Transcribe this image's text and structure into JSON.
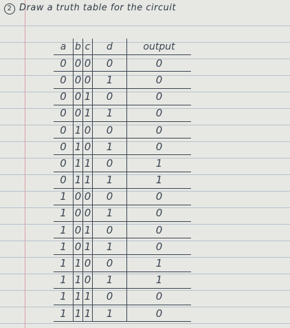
{
  "heading": {
    "number": "2",
    "text": "Draw a truth table for the circuit"
  },
  "table": {
    "columns": [
      "a",
      "b",
      "c",
      "d",
      "output"
    ],
    "rows": [
      [
        "0",
        "0",
        "0",
        "0",
        "0"
      ],
      [
        "0",
        "0",
        "0",
        "1",
        "0"
      ],
      [
        "0",
        "0",
        "1",
        "0",
        "0"
      ],
      [
        "0",
        "0",
        "1",
        "1",
        "0"
      ],
      [
        "0",
        "1",
        "0",
        "0",
        "0"
      ],
      [
        "0",
        "1",
        "0",
        "1",
        "0"
      ],
      [
        "0",
        "1",
        "1",
        "0",
        "1"
      ],
      [
        "0",
        "1",
        "1",
        "1",
        "1"
      ],
      [
        "1",
        "0",
        "0",
        "0",
        "0"
      ],
      [
        "1",
        "0",
        "0",
        "1",
        "0"
      ],
      [
        "1",
        "0",
        "1",
        "0",
        "0"
      ],
      [
        "1",
        "0",
        "1",
        "1",
        "0"
      ],
      [
        "1",
        "1",
        "0",
        "0",
        "1"
      ],
      [
        "1",
        "1",
        "0",
        "1",
        "1"
      ],
      [
        "1",
        "1",
        "1",
        "0",
        "0"
      ],
      [
        "1",
        "1",
        "1",
        "1",
        "0"
      ]
    ]
  }
}
